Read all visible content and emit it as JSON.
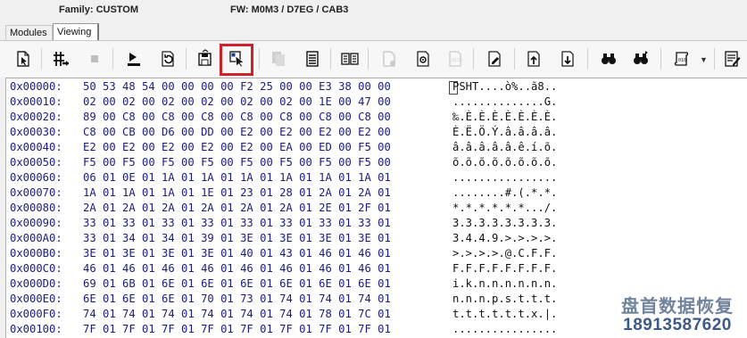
{
  "header": {
    "family": "Family: CUSTOM",
    "firmware": "FW: M0M3 / D7EG / CAB3"
  },
  "tabs": [
    {
      "label": "Modules",
      "active": false
    },
    {
      "label": "Viewing",
      "active": true
    }
  ],
  "toolbar": {
    "buttons": [
      {
        "icon": "open-file-icon",
        "enabled": true
      },
      {
        "icon": "goto-offset-icon",
        "enabled": true
      },
      {
        "icon": "stop-icon",
        "enabled": false
      },
      {
        "icon": "read-to-end-icon",
        "enabled": true
      },
      {
        "icon": "refresh-icon",
        "enabled": true
      },
      {
        "icon": "save-disk-icon",
        "enabled": true
      },
      {
        "icon": "select-cursor-icon",
        "enabled": true,
        "highlighted": true
      },
      {
        "icon": "copy-icon",
        "enabled": false
      },
      {
        "icon": "stack-icon",
        "enabled": true
      },
      {
        "icon": "compare-icon",
        "enabled": true
      },
      {
        "icon": "new-page-icon",
        "enabled": false
      },
      {
        "icon": "page-settings-icon",
        "enabled": true
      },
      {
        "icon": "page-hex-icon",
        "enabled": false
      },
      {
        "icon": "page-edit-icon",
        "enabled": true
      },
      {
        "icon": "page-up-icon",
        "enabled": true
      },
      {
        "icon": "page-down-icon",
        "enabled": true
      },
      {
        "icon": "find-icon",
        "enabled": true
      },
      {
        "icon": "find-next-icon",
        "enabled": true
      },
      {
        "icon": "script-icon",
        "enabled": true
      },
      {
        "icon": "notes-icon",
        "enabled": true
      }
    ],
    "highlight_color": "#d0202a"
  },
  "hexview": {
    "rows": [
      {
        "addr": "0x00000:",
        "bytes": "50 53 48 54 00 00 00 00 F2 25 00 00 E3 38 00 00",
        "ascii": "PSHT....ò%..ã8.."
      },
      {
        "addr": "0x00010:",
        "bytes": "02 00 02 00 02 00 02 00 02 00 02 00 1E 00 47 00",
        "ascii": "..............G."
      },
      {
        "addr": "0x00020:",
        "bytes": "89 00 C8 00 C8 00 C8 00 C8 00 C8 00 C8 00 C8 00",
        "ascii": "‰.È.È.È.È.È.È.È."
      },
      {
        "addr": "0x00030:",
        "bytes": "C8 00 CB 00 D6 00 DD 00 E2 00 E2 00 E2 00 E2 00",
        "ascii": "È.Ë.Ö.Ý.â.â.â.â."
      },
      {
        "addr": "0x00040:",
        "bytes": "E2 00 E2 00 E2 00 E2 00 E2 00 EA 00 ED 00 F5 00",
        "ascii": "â.â.â.â.â.ê.í.õ."
      },
      {
        "addr": "0x00050:",
        "bytes": "F5 00 F5 00 F5 00 F5 00 F5 00 F5 00 F5 00 F5 00",
        "ascii": "õ.õ.õ.õ.õ.õ.õ.õ."
      },
      {
        "addr": "0x00060:",
        "bytes": "06 01 0E 01 1A 01 1A 01 1A 01 1A 01 1A 01 1A 01",
        "ascii": "................"
      },
      {
        "addr": "0x00070:",
        "bytes": "1A 01 1A 01 1A 01 1E 01 23 01 28 01 2A 01 2A 01",
        "ascii": "........#.(.*.*."
      },
      {
        "addr": "0x00080:",
        "bytes": "2A 01 2A 01 2A 01 2A 01 2A 01 2A 01 2E 01 2F 01",
        "ascii": "*.*.*.*.*.*.../."
      },
      {
        "addr": "0x00090:",
        "bytes": "33 01 33 01 33 01 33 01 33 01 33 01 33 01 33 01",
        "ascii": "3.3.3.3.3.3.3.3."
      },
      {
        "addr": "0x000A0:",
        "bytes": "33 01 34 01 34 01 39 01 3E 01 3E 01 3E 01 3E 01",
        "ascii": "3.4.4.9.>.>.>.>."
      },
      {
        "addr": "0x000B0:",
        "bytes": "3E 01 3E 01 3E 01 3E 01 40 01 43 01 46 01 46 01",
        "ascii": ">.>.>.>.@.C.F.F."
      },
      {
        "addr": "0x000C0:",
        "bytes": "46 01 46 01 46 01 46 01 46 01 46 01 46 01 46 01",
        "ascii": "F.F.F.F.F.F.F.F."
      },
      {
        "addr": "0x000D0:",
        "bytes": "69 01 6B 01 6E 01 6E 01 6E 01 6E 01 6E 01 6E 01",
        "ascii": "i.k.n.n.n.n.n.n."
      },
      {
        "addr": "0x000E0:",
        "bytes": "6E 01 6E 01 6E 01 70 01 73 01 74 01 74 01 74 01",
        "ascii": "n.n.n.p.s.t.t.t."
      },
      {
        "addr": "0x000F0:",
        "bytes": "74 01 74 01 74 01 74 01 74 01 74 01 78 01 7C 01",
        "ascii": "t.t.t.t.t.t.x.|."
      },
      {
        "addr": "0x00100:",
        "bytes": "7F 01 7F 01 7F 01 7F 01 7F 01 7F 01 7F 01 7F 01",
        "ascii": "................"
      }
    ]
  },
  "watermark": {
    "line1": "盘首数据恢复",
    "line2": "18913587620"
  }
}
